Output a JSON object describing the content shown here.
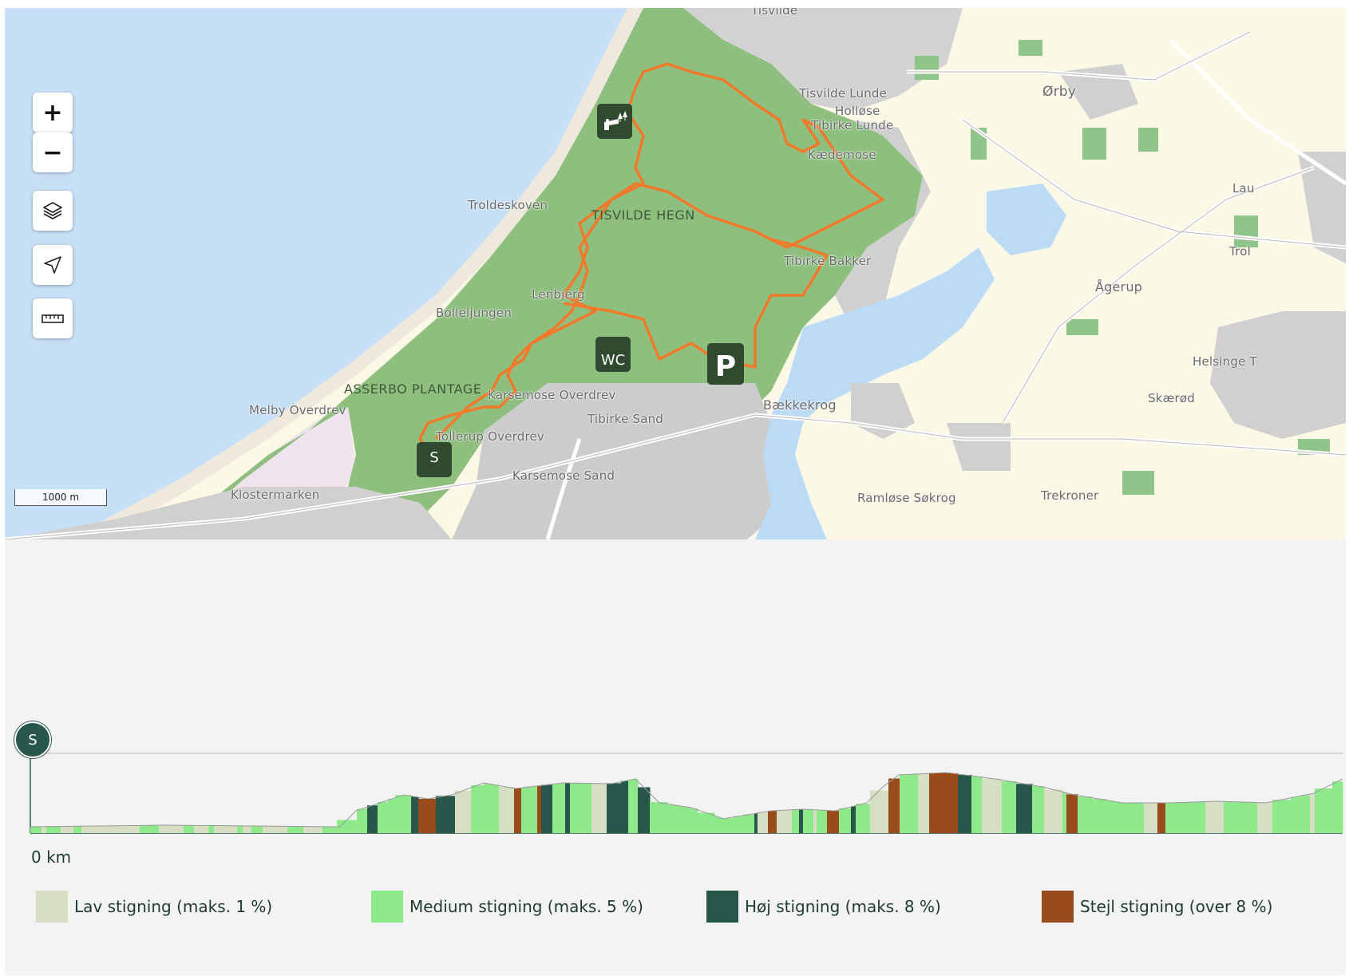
{
  "map": {
    "places": [
      {
        "name": "Tisvilde Lunde"
      },
      {
        "name": "Holløse"
      },
      {
        "name": "Tibirke Lunde"
      },
      {
        "name": "Kædemose"
      },
      {
        "name": "Ørby"
      },
      {
        "name": "Troldeskoven"
      },
      {
        "name": "TISVILDE HEGN"
      },
      {
        "name": "Tibirke Bakker"
      },
      {
        "name": "Ågerup"
      },
      {
        "name": "Lenbjerg"
      },
      {
        "name": "Bolleljungen"
      },
      {
        "name": "ASSERBO PLANTAGE"
      },
      {
        "name": "Karsemose Overdrev"
      },
      {
        "name": "Tibirke Sand"
      },
      {
        "name": "Tollerup Overdrev"
      },
      {
        "name": "Karsemose Sand"
      },
      {
        "name": "Melby Overdrev"
      },
      {
        "name": "Bækkekrog"
      },
      {
        "name": "Klostermarken"
      },
      {
        "name": "Ramløse Søkrog"
      },
      {
        "name": "Trekroner"
      },
      {
        "name": "Skærød"
      },
      {
        "name": "Helsinge T"
      },
      {
        "name": "Lau"
      },
      {
        "name": "Trol"
      },
      {
        "name": "Tisvilde"
      }
    ],
    "controls": {
      "zoom_in": "+",
      "zoom_out": "−"
    },
    "scale_label": "1000 m",
    "poi": {
      "start": "S",
      "wc": "WC",
      "parking": "P"
    },
    "colors": {
      "sea": "#c8e0f7",
      "forest": "#8fbf7f",
      "urban": "#cfcfcf",
      "route": "#f07a2a",
      "poi_bg": "#2f4a2f"
    }
  },
  "profile": {
    "start_marker": "S",
    "axis_start_label": "0 km",
    "legend": [
      {
        "label": "Lav stigning (maks. 1 %)",
        "color": "#d6dfc4"
      },
      {
        "label": "Medium stigning (maks. 5 %)",
        "color": "#8ee98b"
      },
      {
        "label": "Høj stigning (maks. 8 %)",
        "color": "#27574b"
      },
      {
        "label": "Stejl stigning (over 8 %)",
        "color": "#9a4b1c"
      }
    ]
  }
}
